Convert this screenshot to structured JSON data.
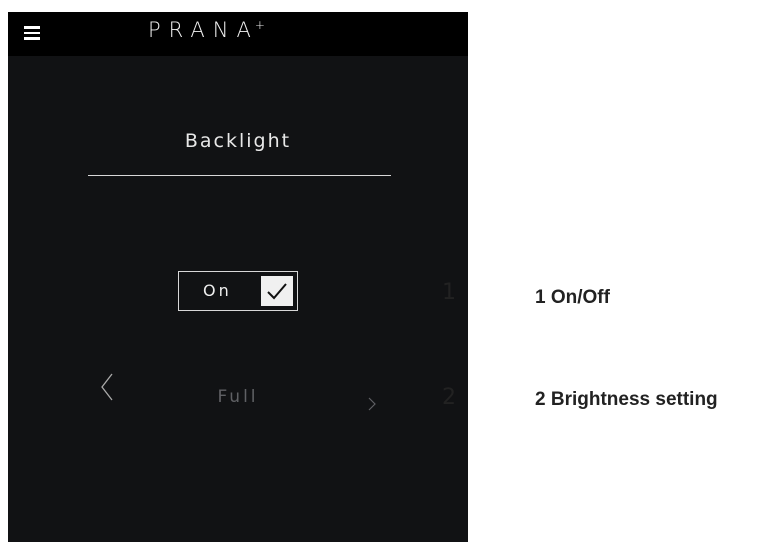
{
  "app": {
    "logo": "PRANA",
    "logo_sup": "+"
  },
  "screen": {
    "title": "Backlight"
  },
  "backlight_toggle": {
    "label": "On",
    "checked": true
  },
  "brightness": {
    "value": "Full",
    "prev_icon": "chevron-left-icon",
    "next_icon": "chevron-right-icon"
  },
  "markers": [
    "1",
    "2"
  ],
  "legend": [
    {
      "number": "1",
      "text": "On/Off"
    },
    {
      "number": "2",
      "text": "Brightness setting"
    }
  ],
  "colors": {
    "screen_bg": "#111214",
    "topbar_bg": "#000000",
    "text": "#e8e8e8",
    "dim_text": "#5f6064"
  }
}
